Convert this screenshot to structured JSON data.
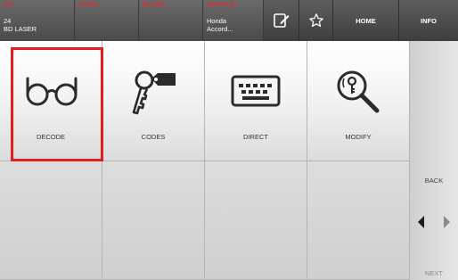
{
  "header": {
    "sn": {
      "label": "SN:",
      "value_line1": "24",
      "value_line2": "BD LASER"
    },
    "code": {
      "label": "CODE:"
    },
    "blank": {
      "label": "BLANK:"
    },
    "vehicle": {
      "label": "VEHICLE:",
      "value_line1": "Honda",
      "value_line2": "Accord..."
    },
    "home_label": "HOME",
    "info_label": "INFO"
  },
  "menu": {
    "decode_label": "DECODE",
    "codes_label": "CODES",
    "direct_label": "DIRECT",
    "modify_label": "MODIFY"
  },
  "side": {
    "back_label": "BACK",
    "next_label": "NEXT"
  },
  "colors": {
    "header_label": "#d93030",
    "highlight": "#e02020"
  }
}
